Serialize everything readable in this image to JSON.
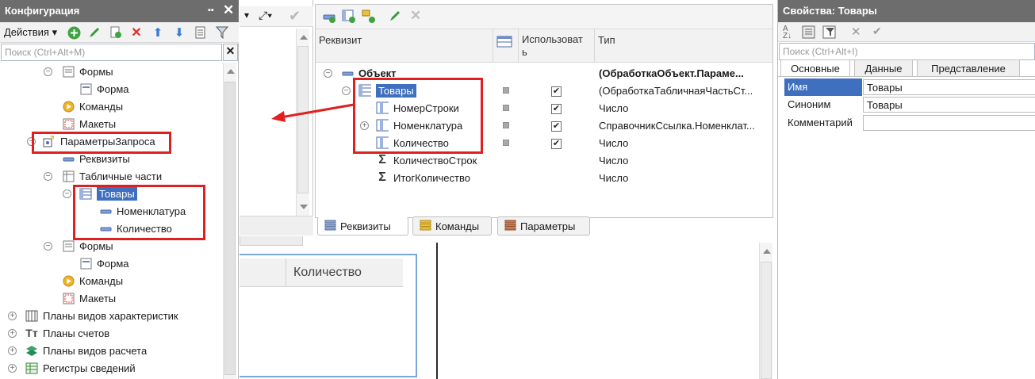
{
  "config_panel": {
    "title": "Конфигурация",
    "actions_label": "Действия ▾",
    "search_placeholder": "Поиск (Ctrl+Alt+M)",
    "tree": [
      {
        "label": "Формы",
        "icon": "form-group-icon"
      },
      {
        "label": "Форма",
        "icon": "form-icon"
      },
      {
        "label": "Команды",
        "icon": "commands-icon"
      },
      {
        "label": "Макеты",
        "icon": "templates-icon"
      },
      {
        "label": "ПараметрыЗапроса",
        "icon": "data-processor-icon"
      },
      {
        "label": "Реквизиты",
        "icon": "attribute-icon"
      },
      {
        "label": "Табличные части",
        "icon": "tabular-parts-icon"
      },
      {
        "label": "Товары",
        "icon": "tabular-part-icon"
      },
      {
        "label": "Номенклатура",
        "icon": "attribute-icon"
      },
      {
        "label": "Количество",
        "icon": "attribute-icon"
      },
      {
        "label": "Формы",
        "icon": "form-group-icon"
      },
      {
        "label": "Форма",
        "icon": "form-icon"
      },
      {
        "label": "Команды",
        "icon": "commands-icon"
      },
      {
        "label": "Макеты",
        "icon": "templates-icon"
      },
      {
        "label": "Планы видов характеристик",
        "icon": "chart-of-characteristics-icon"
      },
      {
        "label": "Планы счетов",
        "icon": "chart-of-accounts-icon"
      },
      {
        "label": "Планы видов расчета",
        "icon": "chart-of-calculation-icon"
      },
      {
        "label": "Регистры сведений",
        "icon": "information-register-icon"
      }
    ]
  },
  "center": {
    "headers": {
      "attribute": "Реквизит",
      "use": "Использоват ь",
      "type": "Тип"
    },
    "rows": [
      {
        "name": "Объект",
        "type": "(ОбработкаОбъект.Параме...",
        "bold": true
      },
      {
        "name": "Товары",
        "type": "(ОбработкаТабличнаяЧастьСт..."
      },
      {
        "name": "НомерСтроки",
        "type": "Число"
      },
      {
        "name": "Номенклатура",
        "type": "СправочникСсылка.Номенклат..."
      },
      {
        "name": "Количество",
        "type": "Число"
      },
      {
        "name": "КоличествоСтрок",
        "type": "Число"
      },
      {
        "name": "ИтогКоличество",
        "type": "Число"
      }
    ],
    "tabs": [
      "Реквизиты",
      "Команды",
      "Параметры"
    ],
    "form_table_header": "Количество"
  },
  "properties": {
    "title": "Свойства: Товары",
    "search_placeholder": "Поиск (Ctrl+Alt+I)",
    "tabs": [
      "Основные",
      "Данные",
      "Представление"
    ],
    "fields": [
      {
        "label": "Имя",
        "value": "Товары"
      },
      {
        "label": "Синоним",
        "value": "Товары"
      },
      {
        "label": "Комментарий",
        "value": ""
      }
    ]
  },
  "colors": {
    "selection": "#3f6fbf",
    "highlight_box": "#e02020",
    "title_bar": "#6d6d6d"
  }
}
